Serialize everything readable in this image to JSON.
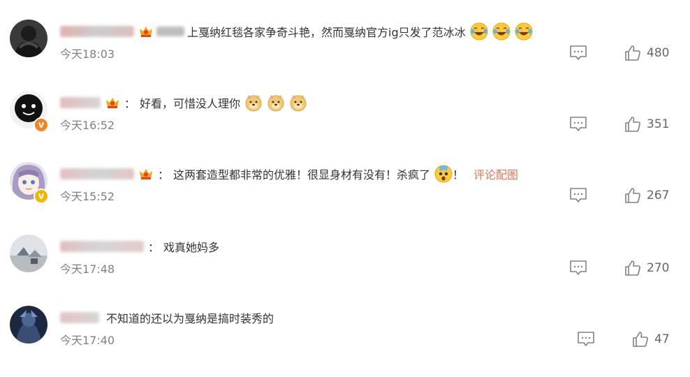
{
  "comments": [
    {
      "separator": "",
      "text": "上戛纳红毯各家争奇斗艳，然而戛纳官方ig只发了范冰冰",
      "emojis": [
        "laugh-cry-emoji",
        "laugh-cry-emoji",
        "laugh-cry-emoji"
      ],
      "link": "",
      "time": "今天18:03",
      "likes": "480",
      "verified": false,
      "avatar_color": "#2a2a2a"
    },
    {
      "separator": "：",
      "text": "好看，可惜没人理你",
      "emojis": [
        "doge-emoji",
        "doge-emoji",
        "doge-emoji"
      ],
      "link": "",
      "time": "今天16:52",
      "likes": "351",
      "verified": true,
      "verified_color": "#f5841f",
      "avatar_color": "#1a1a1a"
    },
    {
      "separator": "：",
      "text": "这两套造型都非常的优雅！很显身材有没有！杀疯了",
      "emojis": [
        "shocked-emoji"
      ],
      "text_after": "！",
      "link": "评论配图",
      "time": "今天15:52",
      "likes": "267",
      "verified": true,
      "verified_color": "#f2b600",
      "avatar_color": "#b9a9c9"
    },
    {
      "separator": "：",
      "text": "戏真她妈多",
      "emojis": [],
      "link": "",
      "time": "今天17:48",
      "likes": "270",
      "verified": false,
      "avatar_color": "#c8cdd2"
    },
    {
      "separator": "",
      "text": "不知道的还以为戛纳是搞时装秀的",
      "emojis": [],
      "link": "",
      "time": "今天17:40",
      "likes": "47",
      "verified": false,
      "avatar_color": "#2c3a55"
    }
  ],
  "icons": {
    "reply": "comment-icon",
    "like": "thumbs-up-icon"
  },
  "colors": {
    "link": "#eb7350",
    "time": "#808080",
    "verified_orange": "#f5841f",
    "verified_gold": "#f2b600"
  }
}
